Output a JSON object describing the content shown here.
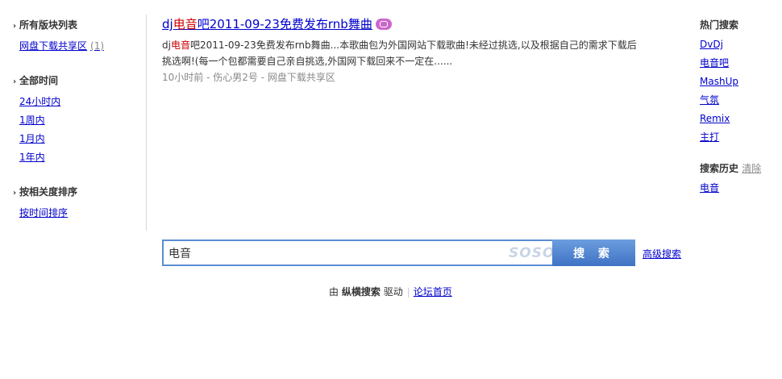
{
  "sidebar": {
    "forum_list": {
      "title": "所有版块列表",
      "items": [
        {
          "label": "网盘下载共享区",
          "count": "(1)"
        }
      ]
    },
    "time_filter": {
      "title": "全部时间",
      "items": [
        {
          "label": "24小时内"
        },
        {
          "label": "1周内"
        },
        {
          "label": "1月内"
        },
        {
          "label": "1年内"
        }
      ]
    },
    "sort_filter": {
      "title": "按相关度排序",
      "items": [
        {
          "label": "按时间排序"
        }
      ]
    }
  },
  "result": {
    "title_prefix": "dj",
    "title_highlight": "电音",
    "title_suffix": "吧2011-09-23免费发布rnb舞曲",
    "snippet_prefix": "dj",
    "snippet_highlight": "电音",
    "snippet_suffix": "吧2011-09-23免费发布rnb舞曲...本歌曲包为外国网站下载歌曲!未经过挑选,以及根据自己的需求下载后挑选啊!(每一个包都需要自己亲自挑选,外国网下载回来不一定在......",
    "meta": "10小时前 - 伤心男2号 - 网盘下载共享区"
  },
  "hot_search": {
    "title": "热门搜索",
    "items": [
      "DvDj",
      "电音吧",
      "MashUp",
      "气氛",
      "Remix",
      "主打"
    ]
  },
  "history": {
    "title": "搜索历史",
    "clear_label": "清除",
    "items": [
      "电音"
    ]
  },
  "search": {
    "value": "电音",
    "logo": "SOSO",
    "button_label": "搜 索",
    "advanced_label": "高级搜索"
  },
  "footer": {
    "by_label": "由",
    "engine_label": "纵横搜索",
    "powered_label": "驱动",
    "home_link": "论坛首页"
  },
  "colors": {
    "link": "#0000cc",
    "highlight": "#cc0000",
    "button": "#4a7fcc",
    "border": "#5b8dd3"
  }
}
